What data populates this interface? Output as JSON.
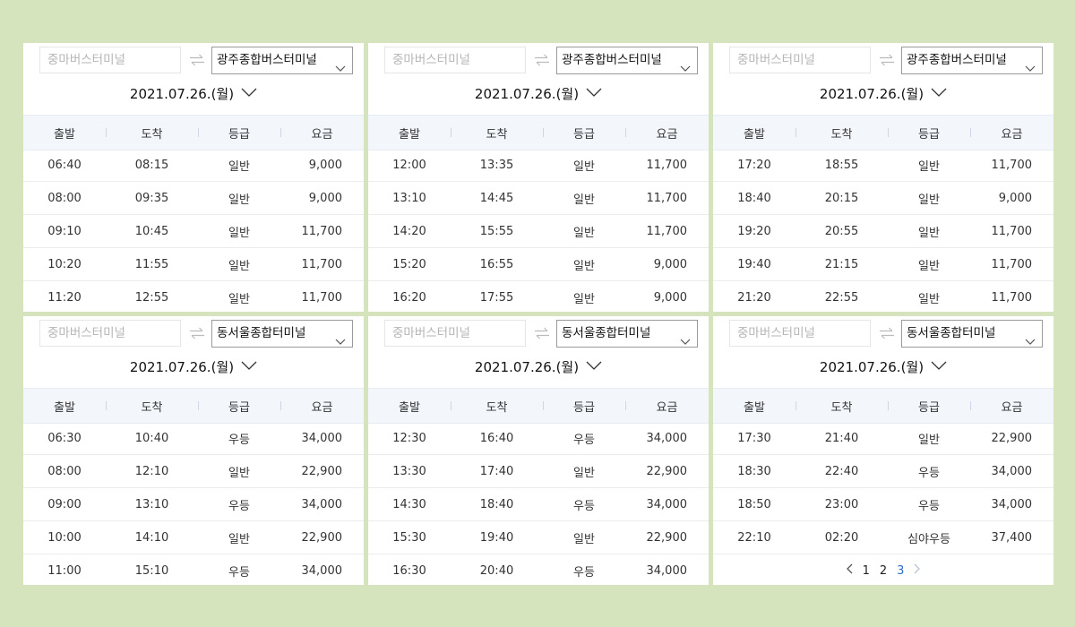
{
  "pagination": {
    "pages": [
      "1",
      "2",
      "3"
    ],
    "current": "3"
  },
  "panels": [
    {
      "origin_placeholder": "중마버스터미널",
      "destination": "광주종합버스터미널",
      "date": "2021.07.26.(월)",
      "headers": [
        "출발",
        "도착",
        "등급",
        "요금"
      ],
      "rows": [
        [
          "06:40",
          "08:15",
          "일반",
          "9,000"
        ],
        [
          "08:00",
          "09:35",
          "일반",
          "9,000"
        ],
        [
          "09:10",
          "10:45",
          "일반",
          "11,700"
        ],
        [
          "10:20",
          "11:55",
          "일반",
          "11,700"
        ],
        [
          "11:20",
          "12:55",
          "일반",
          "11,700"
        ]
      ]
    },
    {
      "origin_placeholder": "중마버스터미널",
      "destination": "광주종합버스터미널",
      "date": "2021.07.26.(월)",
      "headers": [
        "출발",
        "도착",
        "등급",
        "요금"
      ],
      "rows": [
        [
          "12:00",
          "13:35",
          "일반",
          "11,700"
        ],
        [
          "13:10",
          "14:45",
          "일반",
          "11,700"
        ],
        [
          "14:20",
          "15:55",
          "일반",
          "11,700"
        ],
        [
          "15:20",
          "16:55",
          "일반",
          "9,000"
        ],
        [
          "16:20",
          "17:55",
          "일반",
          "9,000"
        ]
      ]
    },
    {
      "origin_placeholder": "중마버스터미널",
      "destination": "광주종합버스터미널",
      "date": "2021.07.26.(월)",
      "headers": [
        "출발",
        "도착",
        "등급",
        "요금"
      ],
      "rows": [
        [
          "17:20",
          "18:55",
          "일반",
          "11,700"
        ],
        [
          "18:40",
          "20:15",
          "일반",
          "9,000"
        ],
        [
          "19:20",
          "20:55",
          "일반",
          "11,700"
        ],
        [
          "19:40",
          "21:15",
          "일반",
          "11,700"
        ],
        [
          "21:20",
          "22:55",
          "일반",
          "11,700"
        ]
      ]
    },
    {
      "origin_placeholder": "중마버스터미널",
      "destination": "동서울종합터미널",
      "date": "2021.07.26.(월)",
      "headers": [
        "출발",
        "도착",
        "등급",
        "요금"
      ],
      "rows": [
        [
          "06:30",
          "10:40",
          "우등",
          "34,000"
        ],
        [
          "08:00",
          "12:10",
          "일반",
          "22,900"
        ],
        [
          "09:00",
          "13:10",
          "우등",
          "34,000"
        ],
        [
          "10:00",
          "14:10",
          "일반",
          "22,900"
        ],
        [
          "11:00",
          "15:10",
          "우등",
          "34,000"
        ]
      ]
    },
    {
      "origin_placeholder": "중마버스터미널",
      "destination": "동서울종합터미널",
      "date": "2021.07.26.(월)",
      "headers": [
        "출발",
        "도착",
        "등급",
        "요금"
      ],
      "rows": [
        [
          "12:30",
          "16:40",
          "우등",
          "34,000"
        ],
        [
          "13:30",
          "17:40",
          "일반",
          "22,900"
        ],
        [
          "14:30",
          "18:40",
          "우등",
          "34,000"
        ],
        [
          "15:30",
          "19:40",
          "일반",
          "22,900"
        ],
        [
          "16:30",
          "20:40",
          "우등",
          "34,000"
        ]
      ]
    },
    {
      "origin_placeholder": "중마버스터미널",
      "destination": "동서울종합터미널",
      "date": "2021.07.26.(월)",
      "headers": [
        "출발",
        "도착",
        "등급",
        "요금"
      ],
      "rows": [
        [
          "17:30",
          "21:40",
          "일반",
          "22,900"
        ],
        [
          "18:30",
          "22:40",
          "우등",
          "34,000"
        ],
        [
          "18:50",
          "23:00",
          "우등",
          "34,000"
        ],
        [
          "22:10",
          "02:20",
          "심야우등",
          "37,400"
        ]
      ]
    }
  ]
}
